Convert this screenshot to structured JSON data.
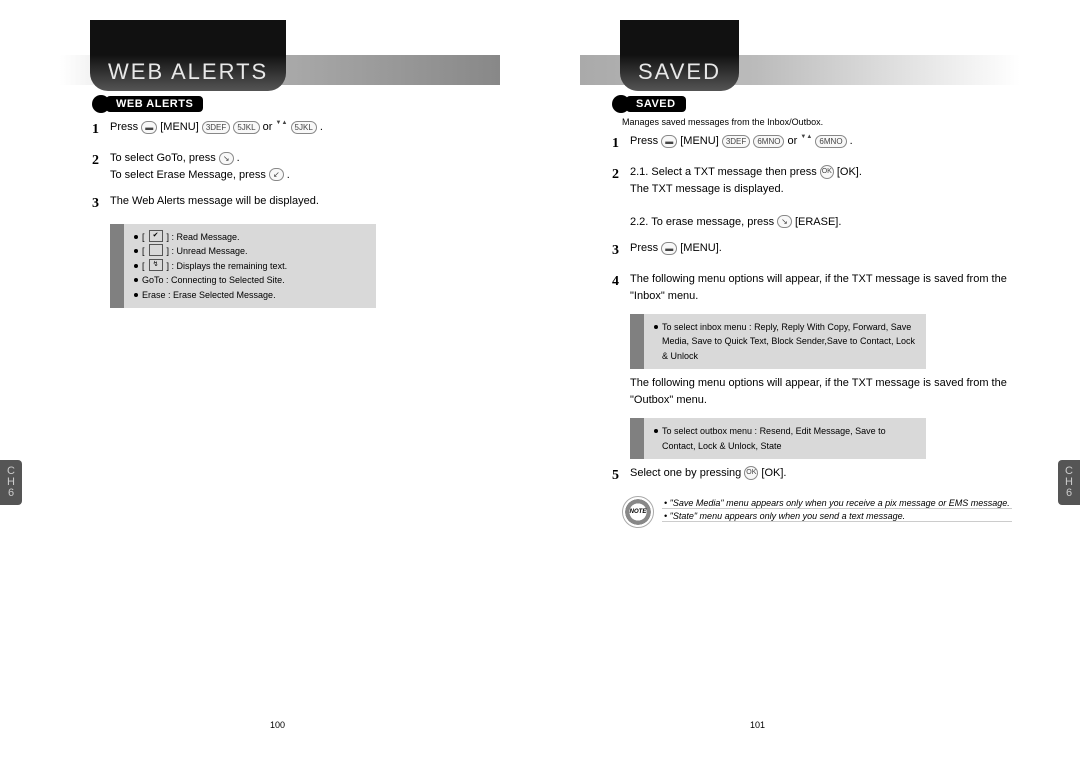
{
  "left_page": {
    "header_title": "WEB ALERTS",
    "section_label": "WEB ALERTS",
    "steps": {
      "s1_num": "1",
      "s1_press": "Press",
      "s1_menu": "[MENU]",
      "s1_or": "or",
      "s1_end": ".",
      "s2_num": "2",
      "s2_line1": "To select GoTo, press",
      "s2_line1_end": ".",
      "s2_line2": "To select Erase Message, press",
      "s2_line2_end": ".",
      "s3_num": "3",
      "s3_text": "The Web Alerts message will be displayed."
    },
    "tip": {
      "l1_prefix": "[",
      "l1_mid": "] : Read Message.",
      "l2_prefix": "[",
      "l2_mid": "] : Unread Message.",
      "l3_prefix": "[",
      "l3_mid": "] : Displays the remaining text.",
      "l4": "GoTo : Connecting to Selected Site.",
      "l5": "Erase : Erase Selected Message."
    },
    "ch_label": "C\nH\n6",
    "page_num": "100"
  },
  "right_page": {
    "header_title": "SAVED",
    "section_label": "SAVED",
    "subhead": "Manages saved messages from the Inbox/Outbox.",
    "steps": {
      "s1_num": "1",
      "s1_press": "Press",
      "s1_menu": "[MENU]",
      "s1_or": "or",
      "s1_end": ".",
      "s2_num": "2",
      "s2_line1": "2.1. Select a TXT message then press",
      "s2_line1_ok": "[OK].",
      "s2_line2": "The TXT message is displayed.",
      "s2_line3": "2.2. To erase message, press",
      "s2_line3_erase": "[ERASE].",
      "s3_num": "3",
      "s3_press": "Press",
      "s3_menu": "[MENU].",
      "s4_num": "4",
      "s4_text": "The following menu options will appear, if the TXT message is saved from the \"Inbox\" menu.",
      "interlude": "The following menu options will appear, if the TXT message is saved from the \"Outbox\" menu.",
      "s5_num": "5",
      "s5_text": "Select one by pressing",
      "s5_ok": "[OK]."
    },
    "tip_inbox": {
      "lead": "To select inbox menu : ",
      "content": "Reply, Reply With Copy, Forward, Save Media, Save to Quick Text, Block Sender,Save to Contact, Lock & Unlock"
    },
    "tip_outbox": {
      "lead": "To select outbox menu : ",
      "content": "Resend, Edit Message, Save to Contact, Lock & Unlock, State"
    },
    "note": {
      "l1": "\"Save Media\" menu appears only when you receive a pix message or EMS message.",
      "l2": "\"State\" menu appears only when you send a text message."
    },
    "ch_label": "C\nH\n6",
    "page_num": "101"
  },
  "keys": {
    "menu_key": "▬",
    "num3": "3DEF",
    "num5": "5JKL",
    "num6": "6MNO",
    "ok": "OK",
    "right_soft": "↘",
    "left_soft": "↙"
  }
}
